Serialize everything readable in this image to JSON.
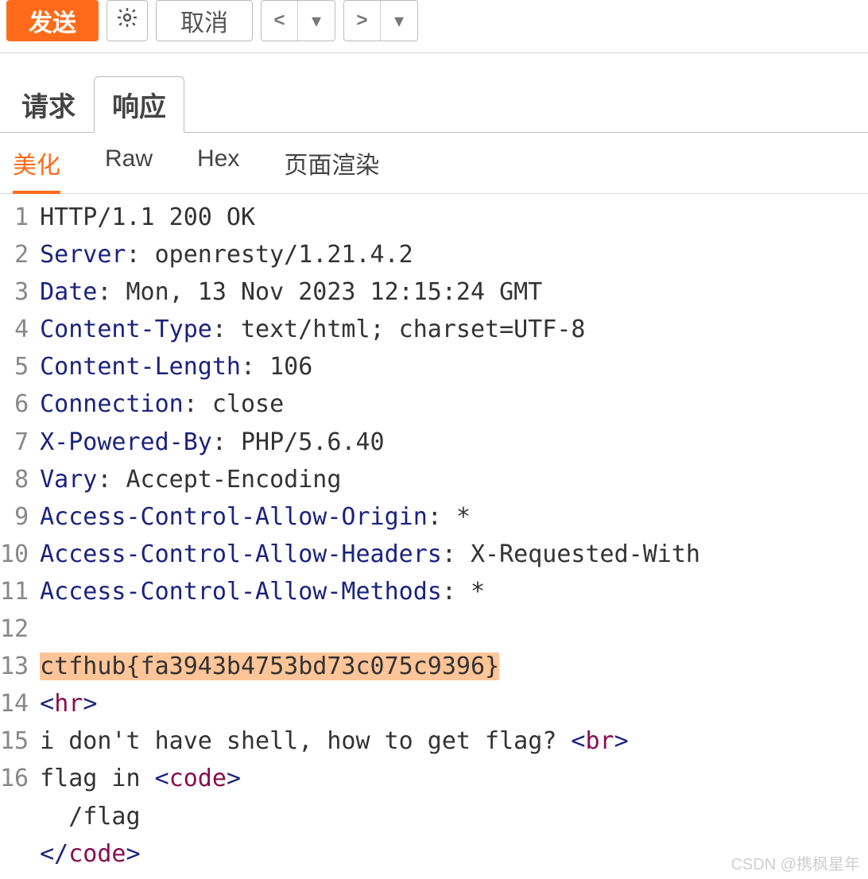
{
  "toolbar": {
    "send_label": "发送",
    "cancel_label": "取消"
  },
  "main_tabs": {
    "request": "请求",
    "response": "响应",
    "active": "response"
  },
  "sub_tabs": {
    "pretty": "美化",
    "raw": "Raw",
    "hex": "Hex",
    "render": "页面渲染",
    "active": "pretty"
  },
  "response": {
    "status_line": "HTTP/1.1 200 OK",
    "headers": [
      {
        "name": "Server",
        "value": "openresty/1.21.4.2"
      },
      {
        "name": "Date",
        "value": "Mon, 13 Nov 2023 12:15:24 GMT"
      },
      {
        "name": "Content-Type",
        "value": "text/html; charset=UTF-8"
      },
      {
        "name": "Content-Length",
        "value": "106"
      },
      {
        "name": "Connection",
        "value": "close"
      },
      {
        "name": "X-Powered-By",
        "value": "PHP/5.6.40"
      },
      {
        "name": "Vary",
        "value": "Accept-Encoding"
      },
      {
        "name": "Access-Control-Allow-Origin",
        "value": "*"
      },
      {
        "name": "Access-Control-Allow-Headers",
        "value": "X-Requested-With"
      },
      {
        "name": "Access-Control-Allow-Methods",
        "value": "*"
      }
    ],
    "body": {
      "flag_line": "ctfhub{fa3943b4753bd73c075c9396}",
      "msg_text": "i don't have shell, how to get flag? ",
      "flag_in_text": "flag in ",
      "code_content": "/flag",
      "tag_hr": "hr",
      "tag_br": "br",
      "tag_code": "code"
    },
    "line_numbers": [
      "1",
      "2",
      "3",
      "4",
      "5",
      "6",
      "7",
      "8",
      "9",
      "10",
      "11",
      "12",
      "13",
      "14",
      "15",
      "16"
    ]
  },
  "watermark": "CSDN @携枫星年"
}
